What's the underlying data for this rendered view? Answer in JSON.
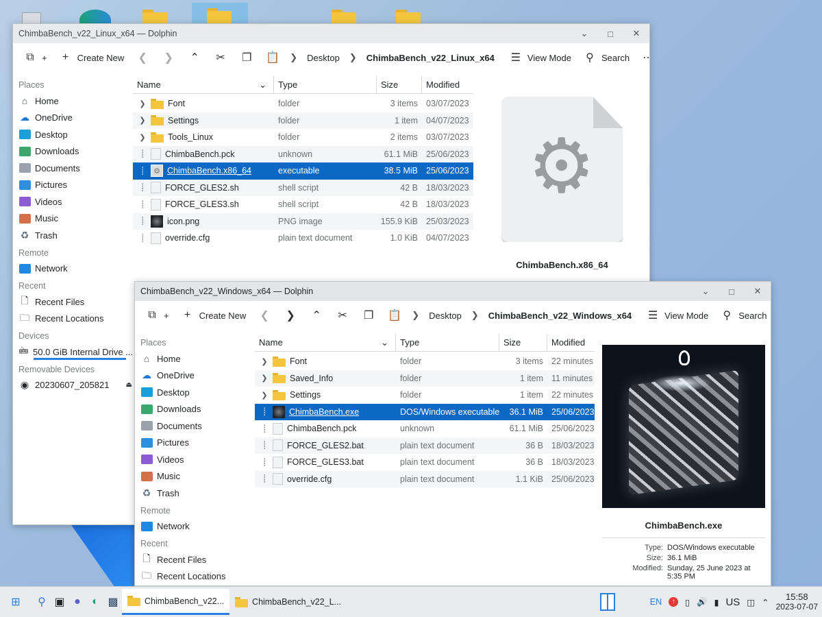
{
  "desktop": {
    "icons": [
      "trash-icon",
      "browser-icon",
      "folder-icon",
      "folder-icon",
      "folder-icon",
      "folder-icon"
    ]
  },
  "win1": {
    "title": "ChimbaBench_v22_Linux_x64 — Dolphin",
    "toolbar": {
      "create_new": "Create New",
      "view_mode": "View Mode",
      "search": "Search"
    },
    "breadcrumb": [
      "Desktop",
      "ChimbaBench_v22_Linux_x64"
    ],
    "places": {
      "places_title": "Places",
      "places": [
        "Home",
        "OneDrive",
        "Desktop",
        "Downloads",
        "Documents",
        "Pictures",
        "Videos",
        "Music",
        "Trash"
      ],
      "remote_title": "Remote",
      "remote": [
        "Network"
      ],
      "recent_title": "Recent",
      "recent": [
        "Recent Files",
        "Recent Locations"
      ],
      "devices_title": "Devices",
      "devices": [
        "50.0 GiB Internal Drive ..."
      ],
      "removable_title": "Removable Devices",
      "removable": [
        "20230607_205821"
      ]
    },
    "columns": [
      "Name",
      "Type",
      "Size",
      "Modified"
    ],
    "files": [
      {
        "name": "Font",
        "type": "folder",
        "size": "3 items",
        "modified": "03/07/2023",
        "kind": "folder"
      },
      {
        "name": "Settings",
        "type": "folder",
        "size": "1 item",
        "modified": "04/07/2023",
        "kind": "folder"
      },
      {
        "name": "Tools_Linux",
        "type": "folder",
        "size": "2 items",
        "modified": "03/07/2023",
        "kind": "folder"
      },
      {
        "name": "ChimbaBench.pck",
        "type": "unknown",
        "size": "61.1 MiB",
        "modified": "25/06/2023",
        "kind": "file"
      },
      {
        "name": "ChimbaBench.x86_64",
        "type": "executable",
        "size": "38.5 MiB",
        "modified": "25/06/2023",
        "kind": "exe",
        "selected": true
      },
      {
        "name": "FORCE_GLES2.sh",
        "type": "shell script",
        "size": "42 B",
        "modified": "18/03/2023",
        "kind": "file"
      },
      {
        "name": "FORCE_GLES3.sh",
        "type": "shell script",
        "size": "42 B",
        "modified": "18/03/2023",
        "kind": "file"
      },
      {
        "name": "icon.png",
        "type": "PNG image",
        "size": "155.9 KiB",
        "modified": "25/03/2023",
        "kind": "img"
      },
      {
        "name": "override.cfg",
        "type": "plain text document",
        "size": "1.0 KiB",
        "modified": "04/07/2023",
        "kind": "file"
      }
    ],
    "preview_name": "ChimbaBench.x86_64"
  },
  "win2": {
    "title": "ChimbaBench_v22_Windows_x64 — Dolphin",
    "toolbar": {
      "create_new": "Create New",
      "view_mode": "View Mode",
      "search": "Search"
    },
    "breadcrumb": [
      "Desktop",
      "ChimbaBench_v22_Windows_x64"
    ],
    "places": {
      "places_title": "Places",
      "places": [
        "Home",
        "OneDrive",
        "Desktop",
        "Downloads",
        "Documents",
        "Pictures",
        "Videos",
        "Music",
        "Trash"
      ],
      "remote_title": "Remote",
      "remote": [
        "Network"
      ],
      "recent_title": "Recent",
      "recent": [
        "Recent Files",
        "Recent Locations"
      ]
    },
    "columns": [
      "Name",
      "Type",
      "Size",
      "Modified"
    ],
    "files": [
      {
        "name": "Font",
        "type": "folder",
        "size": "3 items",
        "modified": "22 minutes",
        "kind": "folder"
      },
      {
        "name": "Saved_Info",
        "type": "folder",
        "size": "1 item",
        "modified": "11 minutes",
        "kind": "folder"
      },
      {
        "name": "Settings",
        "type": "folder",
        "size": "1 item",
        "modified": "22 minutes",
        "kind": "folder"
      },
      {
        "name": "ChimbaBench.exe",
        "type": "DOS/Windows executable",
        "size": "36.1 MiB",
        "modified": "25/06/2023",
        "kind": "img",
        "selected": true
      },
      {
        "name": "ChimbaBench.pck",
        "type": "unknown",
        "size": "61.1 MiB",
        "modified": "25/06/2023",
        "kind": "file"
      },
      {
        "name": "FORCE_GLES2.bat",
        "type": "plain text document",
        "size": "36 B",
        "modified": "18/03/2023",
        "kind": "file"
      },
      {
        "name": "FORCE_GLES3.bat",
        "type": "plain text document",
        "size": "36 B",
        "modified": "18/03/2023",
        "kind": "file"
      },
      {
        "name": "override.cfg",
        "type": "plain text document",
        "size": "1.1 KiB",
        "modified": "25/06/2023",
        "kind": "file"
      }
    ],
    "preview_name": "ChimbaBench.exe",
    "meta": [
      {
        "k": "Type:",
        "v": "DOS/Windows executable"
      },
      {
        "k": "Size:",
        "v": "36.1 MiB"
      },
      {
        "k": "Modified:",
        "v": "Sunday, 25 June 2023 at 5:35 PM"
      }
    ]
  },
  "taskbar": {
    "tasks": [
      "ChimbaBench_v22...",
      "ChimbaBench_v22_L..."
    ],
    "lang": "EN",
    "keyboard": "US",
    "time": "15:58",
    "date": "2023-07-07"
  },
  "colors": {
    "selection": "#0b68c4",
    "folder": "#f5c63d",
    "accent": "#2e7de0"
  }
}
